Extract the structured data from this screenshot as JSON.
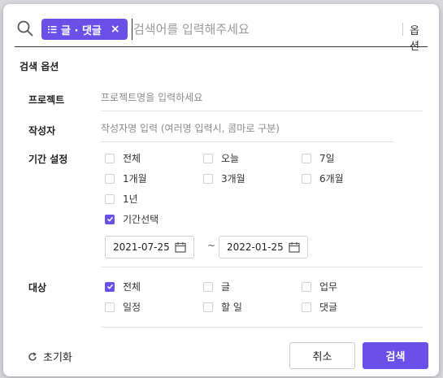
{
  "search": {
    "chip_label": "글 · 댓글",
    "chip_close": "×",
    "placeholder": "검색어를 입력해주세요",
    "options_label": "옵션"
  },
  "options": {
    "section_title": "검색 옵션",
    "project": {
      "label": "프로젝트",
      "placeholder": "프로젝트명을 입력하세요"
    },
    "author": {
      "label": "작성자",
      "placeholder": "작성자명 입력 (여러명 입력시, 콤마로 구분)"
    },
    "period": {
      "label": "기간 설정",
      "items": [
        {
          "label": "전체",
          "checked": false
        },
        {
          "label": "오늘",
          "checked": false
        },
        {
          "label": "7일",
          "checked": false
        },
        {
          "label": "1개월",
          "checked": false
        },
        {
          "label": "3개월",
          "checked": false
        },
        {
          "label": "6개월",
          "checked": false
        },
        {
          "label": "1년",
          "checked": false
        },
        {
          "label": "기간선택",
          "checked": true
        }
      ],
      "start_date": "2021-07-25",
      "end_date": "2022-01-25",
      "separator": "~"
    },
    "target": {
      "label": "대상",
      "items": [
        {
          "label": "전체",
          "checked": true
        },
        {
          "label": "글",
          "checked": false
        },
        {
          "label": "업무",
          "checked": false
        },
        {
          "label": "일정",
          "checked": false
        },
        {
          "label": "할 일",
          "checked": false
        },
        {
          "label": "댓글",
          "checked": false
        }
      ]
    }
  },
  "footer": {
    "reset_label": "초기화",
    "cancel_label": "취소",
    "search_label": "검색"
  },
  "colors": {
    "accent": "#6a4fe8"
  }
}
